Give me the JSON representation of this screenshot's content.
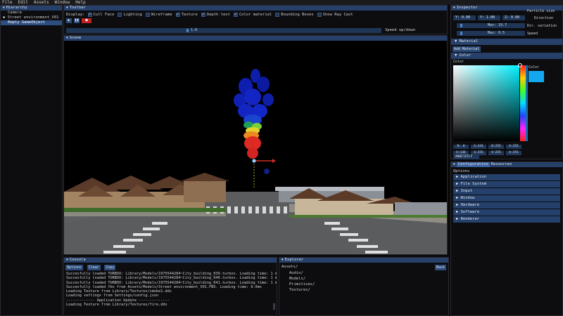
{
  "menu": [
    "File",
    "Edit",
    "Assets",
    "Window",
    "Help"
  ],
  "hierarchy": {
    "title": "Hierarchy",
    "items": [
      "Camera",
      "Street environment_V01",
      "Empty GameObject"
    ]
  },
  "toolbar": {
    "title": "Toolbar",
    "display_label": "Display:",
    "options": [
      {
        "label": "Cull Face",
        "checked": true
      },
      {
        "label": "Lighting",
        "checked": false
      },
      {
        "label": "Wireframe",
        "checked": false
      },
      {
        "label": "Texture",
        "checked": true
      },
      {
        "label": "Depth test",
        "checked": true
      },
      {
        "label": "Color material",
        "checked": true
      },
      {
        "label": "Bounding Boxes",
        "checked": false
      },
      {
        "label": "Show Ray Cast",
        "checked": false
      }
    ],
    "speed_value": "1.0",
    "speed_label": "Speed up/down"
  },
  "scene": {
    "title": "Scene"
  },
  "console": {
    "title": "Console",
    "buttons": [
      "Options",
      "Clear",
      "Copy"
    ],
    "lines": [
      "Succesfully loaded TURBOX: Library/Models/1975544284~City_building_039.turbox. Loading time: 1 ms",
      "Succesfully loaded TURBOX: Library/Models/1975544284~City_building_040.turbox. Loading time: 1 ms",
      "Succesfully loaded TURBOX: Library/Models/1975544284~City_building_041.turbox. Loading time: 1 ms",
      "Succesfully loaded fbx from Assets/Models/Street environment_V01.FBX. Loading time: 0.0ms",
      "Loading Texture from Library/Textures/smoke1.dds",
      "Loading settings from Settings/config.json",
      "------------- Application Update --------------",
      "Loading Texture from Library/Textures/fire.dds"
    ]
  },
  "explorer": {
    "title": "Explorer",
    "path": "Assets/",
    "back": "Back",
    "folders": [
      "Audio/",
      "Models/",
      "Primitives/",
      "Textures/"
    ]
  },
  "inspector": {
    "title": "Inspector",
    "particle_size_label": "Particle size",
    "direction_label": "Direction",
    "dir_variation_label": "Dir. variation",
    "speed_label": "Speed",
    "row1": [
      "Y: 0.00",
      "Y: 1.00",
      "Z: 0.00"
    ],
    "max1": "Max: 19.7",
    "max2": "Max: 0.5",
    "material_label": "Material",
    "add_material": "Add Material",
    "color_label": "Color",
    "color_text": "Color",
    "accent_color": "#13a7ef",
    "rgba_row1": [
      "R:  0",
      "G:241",
      "B:255",
      "A:255"
    ],
    "rgba_row2": [
      "H:136",
      "S:255",
      "V:255",
      "A:255"
    ],
    "hex": "#00F1FFFF"
  },
  "configuration": {
    "tabs": [
      "Configuration",
      "Resources"
    ],
    "options_label": "Options",
    "sections": [
      "Application",
      "File System",
      "Input",
      "Window",
      "Hardware",
      "Software",
      "Renderer"
    ]
  }
}
